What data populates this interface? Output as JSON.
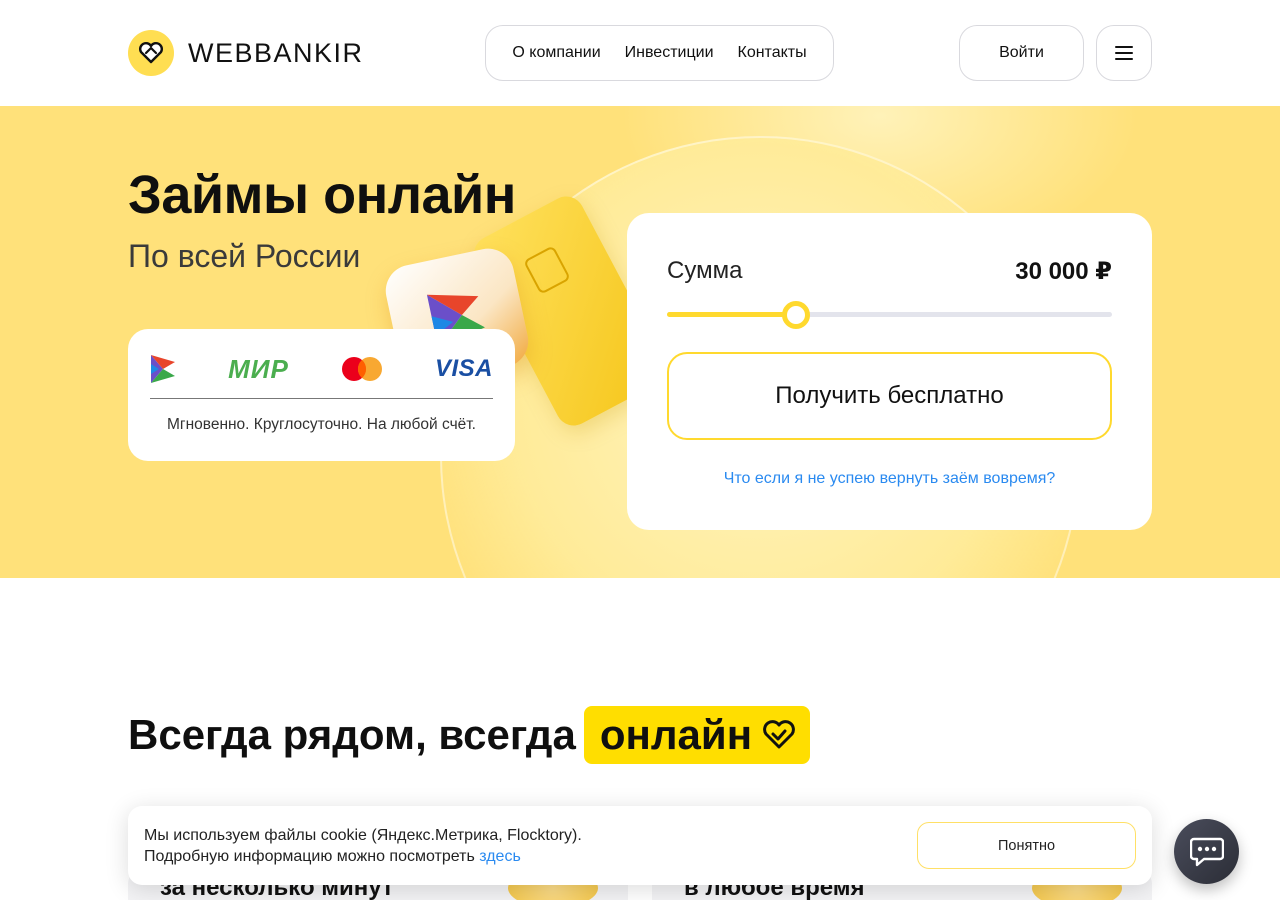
{
  "header": {
    "logo_text": "WEBBANKIR",
    "nav": [
      {
        "label": "О компании"
      },
      {
        "label": "Инвестиции"
      },
      {
        "label": "Контакты"
      }
    ],
    "login_label": "Войти",
    "menu_icon": "hamburger-icon"
  },
  "hero": {
    "title": "Займы онлайн",
    "subtitle": "По всей России",
    "payments": {
      "logos": [
        "sbp-logo",
        "МИР",
        "mastercard-logo",
        "VISA"
      ],
      "mir_text": "МИР",
      "visa_text": "VISA",
      "caption": "Мгновенно. Круглосуточно. На любой счёт."
    }
  },
  "calculator": {
    "amount_label": "Сумма",
    "amount_value": "30 000 ₽",
    "slider_fraction": 0.29,
    "submit_label": "Получить бесплатно",
    "faq_link": "Что если я не успею вернуть заём вовремя?"
  },
  "section": {
    "title": "Всегда рядом, всегда",
    "badge": "онлайн",
    "cards": [
      {
        "title": "за несколько минут"
      },
      {
        "title": "в любое время"
      }
    ]
  },
  "cookie": {
    "line1": "Мы используем файлы cookie (Яндекс.Метрика, Flocktory).",
    "line2": "Подробную информацию можно посмотреть",
    "link": "здесь",
    "button": "Понятно"
  },
  "colors": {
    "accent": "#ffd92e",
    "hero_bg": "#ffe17a",
    "link": "#2a8af0"
  }
}
